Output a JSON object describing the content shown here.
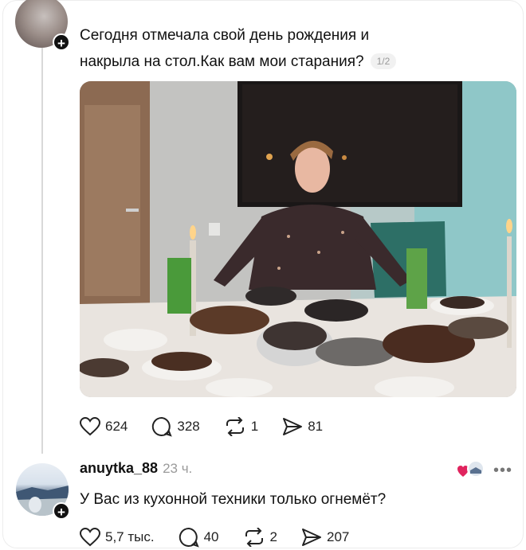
{
  "post": {
    "text_line1": "Сегодня отмечала свой день рождения и",
    "text_line2": "накрыла на стол.Как вам мои старания?",
    "page_indicator": "1/2",
    "actions": {
      "likes": "624",
      "comments": "328",
      "reposts": "1",
      "shares": "81"
    }
  },
  "comment": {
    "username": "anuytka_88",
    "time": "23 ч.",
    "text": "У Вас из кухонной техники только огнемёт?",
    "actions": {
      "likes": "5,7 тыс.",
      "comments": "40",
      "reposts": "2",
      "shares": "207"
    }
  },
  "icons": [
    "heart-icon",
    "comment-bubble-icon",
    "repost-icon",
    "share-send-icon",
    "more-dots-icon",
    "plus-icon"
  ]
}
